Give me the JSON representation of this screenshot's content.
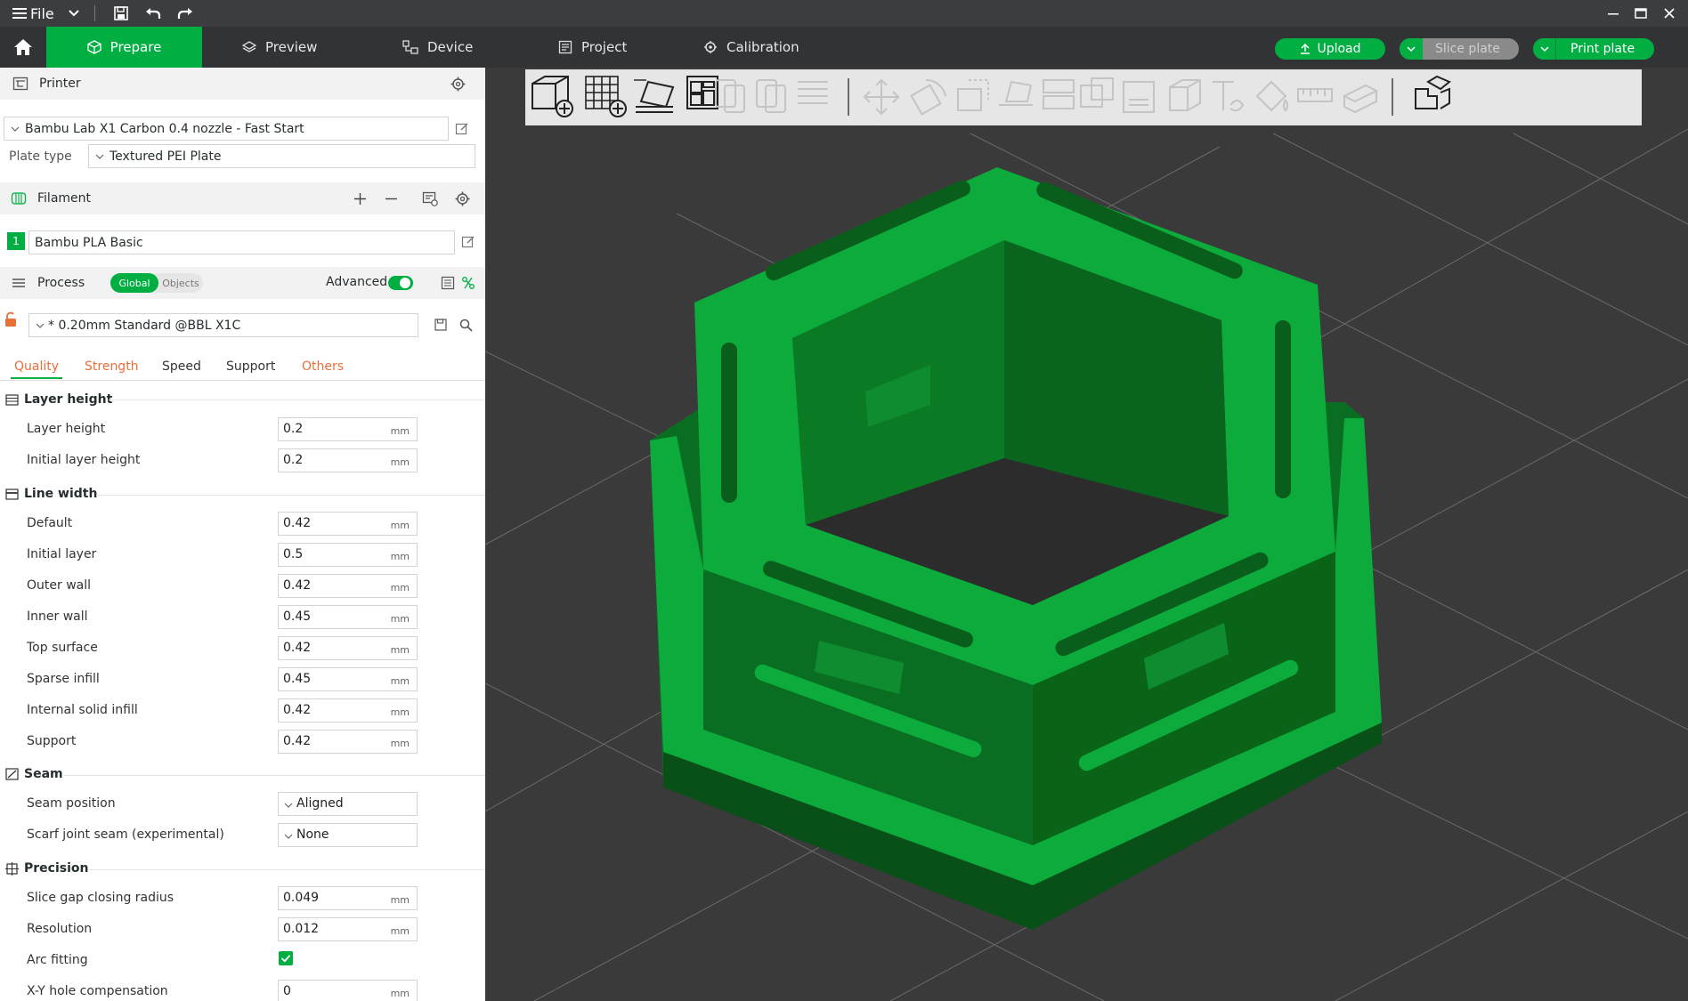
{
  "titlebar": {
    "menu_icon": "hamburger-icon",
    "file_label": "File",
    "icons": [
      "chevron-down-icon",
      "save-icon",
      "undo-icon",
      "redo-icon",
      "minimize-icon",
      "maximize-icon",
      "close-icon"
    ]
  },
  "tabs": [
    {
      "label": "Prepare",
      "icon": "cube-icon",
      "active": true
    },
    {
      "label": "Preview",
      "icon": "layers-icon",
      "active": false
    },
    {
      "label": "Device",
      "icon": "device-icon",
      "active": false
    },
    {
      "label": "Project",
      "icon": "project-icon",
      "active": false
    },
    {
      "label": "Calibration",
      "icon": "calibration-icon",
      "active": false
    }
  ],
  "actions": {
    "upload_label": "Upload",
    "slice_label": "Slice plate",
    "print_label": "Print plate"
  },
  "printer": {
    "header": "Printer",
    "preset": "Bambu Lab X1 Carbon 0.4 nozzle - Fast Start",
    "plate_type_label": "Plate type",
    "plate_type_value": "Textured PEI Plate"
  },
  "filament": {
    "header": "Filament",
    "slot_number": "1",
    "slot_color": "#00ae42",
    "name": "Bambu PLA Basic"
  },
  "process": {
    "header": "Process",
    "toggle_global": "Global",
    "toggle_objects": "Objects",
    "advanced_label": "Advanced",
    "advanced_on": true,
    "preset": "* 0.20mm Standard @BBL X1C"
  },
  "subtabs": [
    {
      "label": "Quality",
      "active": true,
      "modified": true
    },
    {
      "label": "Strength",
      "active": false,
      "modified": true
    },
    {
      "label": "Speed",
      "active": false,
      "modified": false
    },
    {
      "label": "Support",
      "active": false,
      "modified": false
    },
    {
      "label": "Others",
      "active": false,
      "modified": true
    }
  ],
  "groups": {
    "layer_height": {
      "title": "Layer height",
      "rows": [
        {
          "label": "Layer height",
          "value": "0.2",
          "unit": "mm"
        },
        {
          "label": "Initial layer height",
          "value": "0.2",
          "unit": "mm"
        }
      ]
    },
    "line_width": {
      "title": "Line width",
      "rows": [
        {
          "label": "Default",
          "value": "0.42",
          "unit": "mm"
        },
        {
          "label": "Initial layer",
          "value": "0.5",
          "unit": "mm"
        },
        {
          "label": "Outer wall",
          "value": "0.42",
          "unit": "mm"
        },
        {
          "label": "Inner wall",
          "value": "0.45",
          "unit": "mm"
        },
        {
          "label": "Top surface",
          "value": "0.42",
          "unit": "mm"
        },
        {
          "label": "Sparse infill",
          "value": "0.45",
          "unit": "mm"
        },
        {
          "label": "Internal solid infill",
          "value": "0.42",
          "unit": "mm"
        },
        {
          "label": "Support",
          "value": "0.42",
          "unit": "mm"
        }
      ]
    },
    "seam": {
      "title": "Seam",
      "rows": [
        {
          "label": "Seam position",
          "value": "Aligned"
        },
        {
          "label": "Scarf joint seam (experimental)",
          "value": "None"
        }
      ]
    },
    "precision": {
      "title": "Precision",
      "rows": [
        {
          "label": "Slice gap closing radius",
          "value": "0.049",
          "unit": "mm"
        },
        {
          "label": "Resolution",
          "value": "0.012",
          "unit": "mm"
        },
        {
          "label": "Arc fitting",
          "checked": true
        },
        {
          "label": "X-Y hole compensation",
          "value": "0",
          "unit": "mm"
        }
      ]
    }
  },
  "colors": {
    "accent": "#00ae42",
    "modified": "#e8703a",
    "model_light": "#0cab3c",
    "model_dark": "#0a6e22"
  },
  "toolbar3d_icons": [
    "add-object-icon",
    "add-plate-icon",
    "auto-orient-icon",
    "arrange-icon",
    "split-objects-icon",
    "split-parts-icon",
    "layers-editing-icon",
    "move-icon",
    "rotate-icon",
    "scale-icon",
    "lay-on-face-icon",
    "cut-icon",
    "boolean-icon",
    "support-paint-icon",
    "seam-paint-icon",
    "text-icon",
    "color-paint-icon",
    "measure-icon",
    "assembly-icon",
    "explode-icon"
  ]
}
